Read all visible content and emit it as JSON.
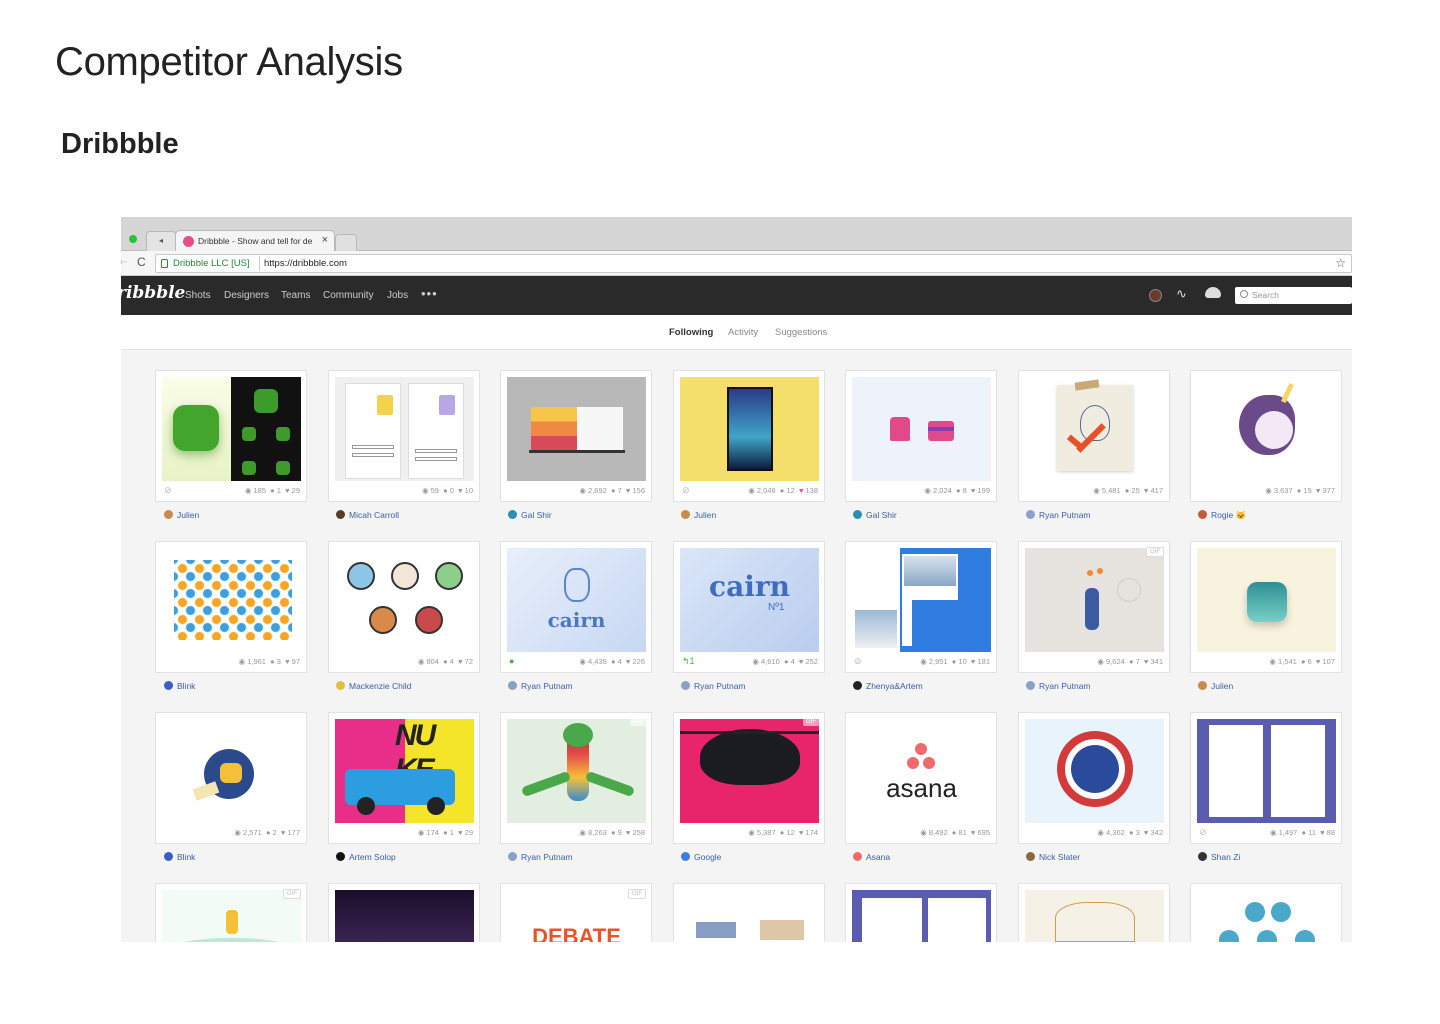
{
  "page": {
    "title": "Competitor Analysis",
    "section": "Dribbble"
  },
  "browser": {
    "tab_title": "Dribbble - Show and tell for de",
    "tab_close": "×",
    "origin": "Dribbble LLC [US]",
    "url": "https://dribbble.com",
    "back": "◂",
    "reload": "C",
    "star": "☆",
    "nav_back": "⇠"
  },
  "topnav": {
    "logo": "ribbble",
    "items": [
      "Shots",
      "Designers",
      "Teams",
      "Community",
      "Jobs"
    ],
    "more": "•••",
    "activity": "∿",
    "search_placeholder": "Search"
  },
  "subnav": {
    "tabs": [
      "Following",
      "Activity",
      "Suggestions"
    ],
    "active": "Following"
  },
  "shots": [
    {
      "views": "185",
      "comments": "1",
      "likes": "29",
      "author": "Julien",
      "link": true
    },
    {
      "views": "59",
      "comments": "0",
      "likes": "10",
      "author": "Micah Carroll"
    },
    {
      "views": "2,692",
      "comments": "7",
      "likes": "156",
      "author": "Gal Shir"
    },
    {
      "views": "2,048",
      "comments": "12",
      "likes": "138",
      "author": "Julien",
      "link": true
    },
    {
      "views": "2,024",
      "comments": "8",
      "likes": "199",
      "author": "Gal Shir"
    },
    {
      "views": "5,481",
      "comments": "25",
      "likes": "417",
      "author": "Ryan Putnam"
    },
    {
      "views": "3,637",
      "comments": "15",
      "likes": "377",
      "author": "Rogie 🐱"
    },
    {
      "views": "1,961",
      "comments": "3",
      "likes": "97",
      "author": "Blink"
    },
    {
      "views": "804",
      "comments": "4",
      "likes": "72",
      "author": "Mackenzie Child"
    },
    {
      "views": "4,439",
      "comments": "4",
      "likes": "226",
      "author": "Ryan Putnam"
    },
    {
      "views": "4,610",
      "comments": "4",
      "likes": "252",
      "author": "Ryan Putnam",
      "rebound": "1"
    },
    {
      "views": "2,951",
      "comments": "10",
      "likes": "181",
      "author": "Zhenya&Artem",
      "link": true
    },
    {
      "views": "9,624",
      "comments": "7",
      "likes": "341",
      "author": "Ryan Putnam",
      "gif": "GIF"
    },
    {
      "views": "1,541",
      "comments": "6",
      "likes": "107",
      "author": "Julien"
    },
    {
      "views": "2,571",
      "comments": "2",
      "likes": "177",
      "author": "Blink"
    },
    {
      "views": "174",
      "comments": "1",
      "likes": "29",
      "author": "Artem Solop"
    },
    {
      "views": "8,263",
      "comments": "9",
      "likes": "258",
      "author": "Ryan Putnam",
      "gif": "GIF"
    },
    {
      "views": "5,387",
      "comments": "12",
      "likes": "174",
      "author": "Google",
      "gif": "GIF"
    },
    {
      "views": "8,492",
      "comments": "81",
      "likes": "695",
      "author": "Asana"
    },
    {
      "views": "4,362",
      "comments": "3",
      "likes": "342",
      "author": "Nick Slater"
    },
    {
      "views": "1,497",
      "comments": "11",
      "likes": "88",
      "author": "Shan Zi",
      "link": true
    },
    {
      "gif": "GIF"
    },
    {},
    {
      "gif": "GIF"
    },
    {},
    {},
    {},
    {}
  ],
  "thumb_text": {
    "cairn1": "cairn",
    "cairn2": "cairn",
    "cairn2_sub": "Nº1",
    "asana": "asana",
    "nuke": "NU KE",
    "debate": "DEBATE"
  },
  "colors": {
    "dribbble_pink": "#ea4c89",
    "nav_bg": "#2a2a2a",
    "link": "#3a5ea8"
  }
}
